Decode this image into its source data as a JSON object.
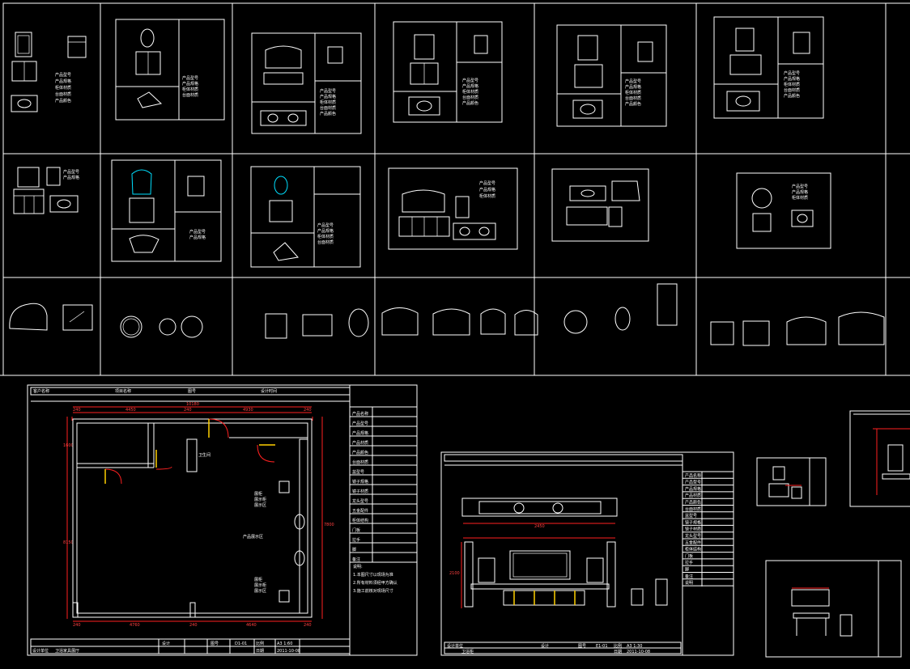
{
  "drawing": {
    "plan_overall_width": "10180",
    "plan_segments_top": [
      "240",
      "4450",
      "240",
      "4930",
      "240"
    ],
    "plan_segments_bottom": [
      "240",
      "4760",
      "240",
      "4640",
      "240"
    ],
    "plan_height_left": "8150",
    "plan_height_right": "7800",
    "plan_upper_left": "1600",
    "plan_room_label": "卫生间",
    "plan_corridor_label": "走廊",
    "plan_shelf_labels": [
      "展柜",
      "展示柜",
      "展示区"
    ],
    "plan_center_label": "产品展示区",
    "plan_title_cells": [
      "客户名称",
      "项目名称",
      "图号",
      "设计时间"
    ],
    "plan_footer_cells": [
      "设计单位",
      "卫浴家具展厅",
      "设计",
      "图号",
      "D1-01",
      "比例",
      "A3 1:60",
      "日期",
      "2011-10-08"
    ],
    "plan_legend_rows": [
      "产品名称",
      "产品型号",
      "产品规格",
      "产品材质",
      "产品颜色",
      "台面材质",
      "盆型号",
      "镜子规格",
      "镜子材质",
      "龙头型号",
      "五金配件",
      "柜体结构",
      "门板",
      "拉手",
      "脚",
      "备注"
    ],
    "plan_notes": [
      "说明:",
      "1.本图尺寸以现场为准",
      "2.所有材料须经甲方确认",
      "3.施工前核对现场尺寸"
    ],
    "elev_dim_top": "2450",
    "elev_height": "2100",
    "elev_footer_cells": [
      "设计单位",
      "卫浴柜",
      "设计",
      "图号",
      "E1-01",
      "比例",
      "A3 1:30",
      "日期",
      "2011-10-08"
    ],
    "elev_legend_rows": [
      "产品名称",
      "产品型号",
      "产品规格",
      "产品材质",
      "产品颜色",
      "台面材质",
      "盆型号",
      "镜子规格",
      "镜子材质",
      "龙头型号",
      "五金配件",
      "柜体结构",
      "门板",
      "拉手",
      "脚",
      "备注",
      "说明"
    ],
    "card_spec_lines": [
      "产品型号",
      "产品规格",
      "柜体材质",
      "台面材质",
      "产品颜色",
      "镜子规格"
    ],
    "card_dims": [
      "1000",
      "800",
      "550",
      "1200",
      "900",
      "600",
      "850"
    ]
  }
}
